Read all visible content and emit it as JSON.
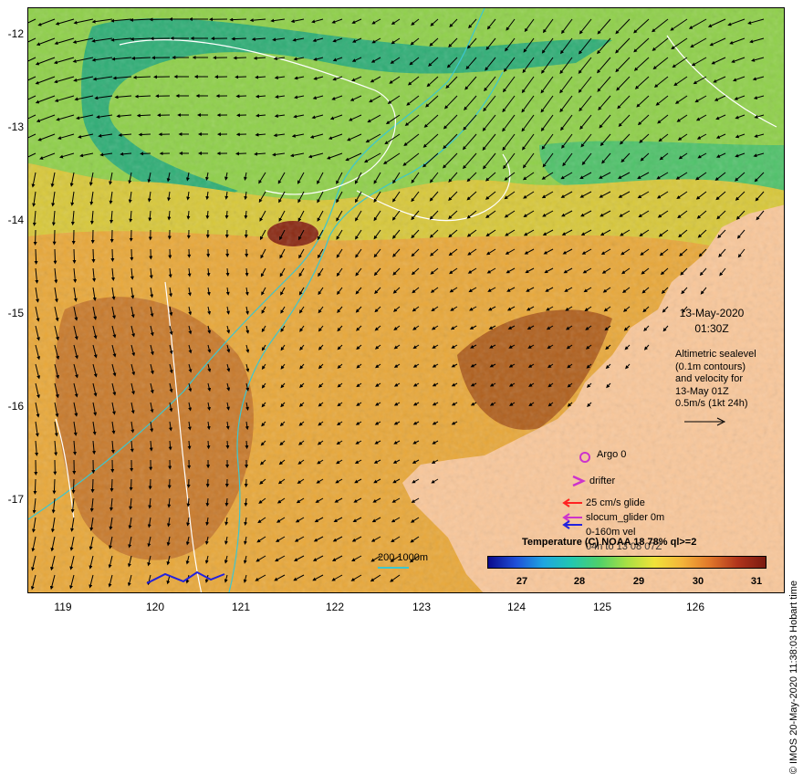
{
  "map": {
    "x_ticks": [
      "119",
      "120",
      "121",
      "122",
      "123",
      "124",
      "125",
      "126"
    ],
    "y_ticks": [
      "-12",
      "-13",
      "-14",
      "-15",
      "-16",
      "-17"
    ],
    "x_range": [
      118.65,
      126.95
    ],
    "y_range": [
      -12.0,
      -17.9
    ],
    "colors": {
      "land": "#f9c79a",
      "ocean_warm": "#e8a83a",
      "ocean_hot": "#c0641f",
      "ocean_cool": "#8fd04a",
      "ocean_cold": "#2fae76",
      "contour": "#ffffff",
      "isobath": "#3cc7d0",
      "vector": "#000000",
      "argo": "#cc33cc",
      "glider_marker": "#2222dd"
    }
  },
  "timestamp": {
    "date": "13-May-2020",
    "time": "01:30Z"
  },
  "altimetric_note": {
    "line1": "Altimetric sealevel",
    "line2": "(0.1m contours)",
    "line3": "and velocity for",
    "line4": "13-May 01Z",
    "line5": "0.5m/s (1kt 24h)"
  },
  "legend": {
    "argo": "Argo 0",
    "drifter": "drifter",
    "glide": "25 cm/s glide",
    "slocum": "slocum_glider 0m",
    "vel": "0-160m vel",
    "overlap_text": "04h to 13 08 07Z",
    "isobaths": "200  1000m",
    "glide_color": "#ff2222",
    "slocum_color": "#cc33cc",
    "vel_color": "#2222dd"
  },
  "colorbar": {
    "title": "Temperature (C) NOAA 18 78% ql>=2",
    "labels": [
      "27",
      "28",
      "29",
      "30",
      "31"
    ],
    "stops": [
      "#0a0a8c",
      "#1f4fd8",
      "#1fa6e0",
      "#22c7b0",
      "#4fd06a",
      "#a8e044",
      "#f0e23a",
      "#f4b43a",
      "#e0762a",
      "#b0341c",
      "#7a1a10"
    ]
  },
  "credit": "© IMOS 20-May-2020 11:38:03 Hobart time"
}
